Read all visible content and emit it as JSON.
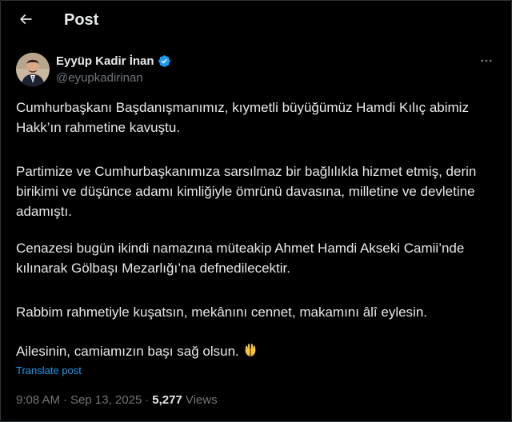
{
  "header": {
    "title": "Post",
    "back_icon": "arrow-left-icon"
  },
  "author": {
    "name": "Eyyüp Kadir İnan",
    "handle": "@eyupkadirinan",
    "verified_icon": "verified-badge-icon",
    "more_icon": "more-horizontal-icon"
  },
  "tweet": {
    "paragraphs": [
      "Cumhurbaşkanı Başdanışmanımız, kıymetli büyüğümüz Hamdi Kılıç abimiz Hakk’ın rahmetine kavuştu.",
      "Partimize ve Cumhurbaşkanımıza sarsılmaz bir bağlılıkla hizmet etmiş, derin birikimi ve düşünce adamı kimliğiyle ömrünü davasına, milletine ve devletine adamıştı.",
      "Cenazesi bugün ikindi namazına müteakip Ahmet Hamdi Akseki Camii’nde kılınarak Gölbaşı Mezarlığı’na defnedilecektir.",
      "Rabbim rahmetiyle kuşatsın, mekânını cennet, makamını âlî eylesin.",
      "Ailesinin, camiamızın başı sağ olsun."
    ],
    "emoji_icon": "praying-hands-icon",
    "translate_label": "Translate post"
  },
  "meta": {
    "time": "9:08 AM",
    "separator": "·",
    "date": "Sep 13, 2025",
    "views_count": "5,277",
    "views_label": "Views"
  },
  "colors": {
    "background": "#000000",
    "text": "#e7e9ea",
    "secondary": "#71767b",
    "link": "#1d9bf0",
    "verified": "#1d9bf0",
    "border": "#2f3336"
  }
}
